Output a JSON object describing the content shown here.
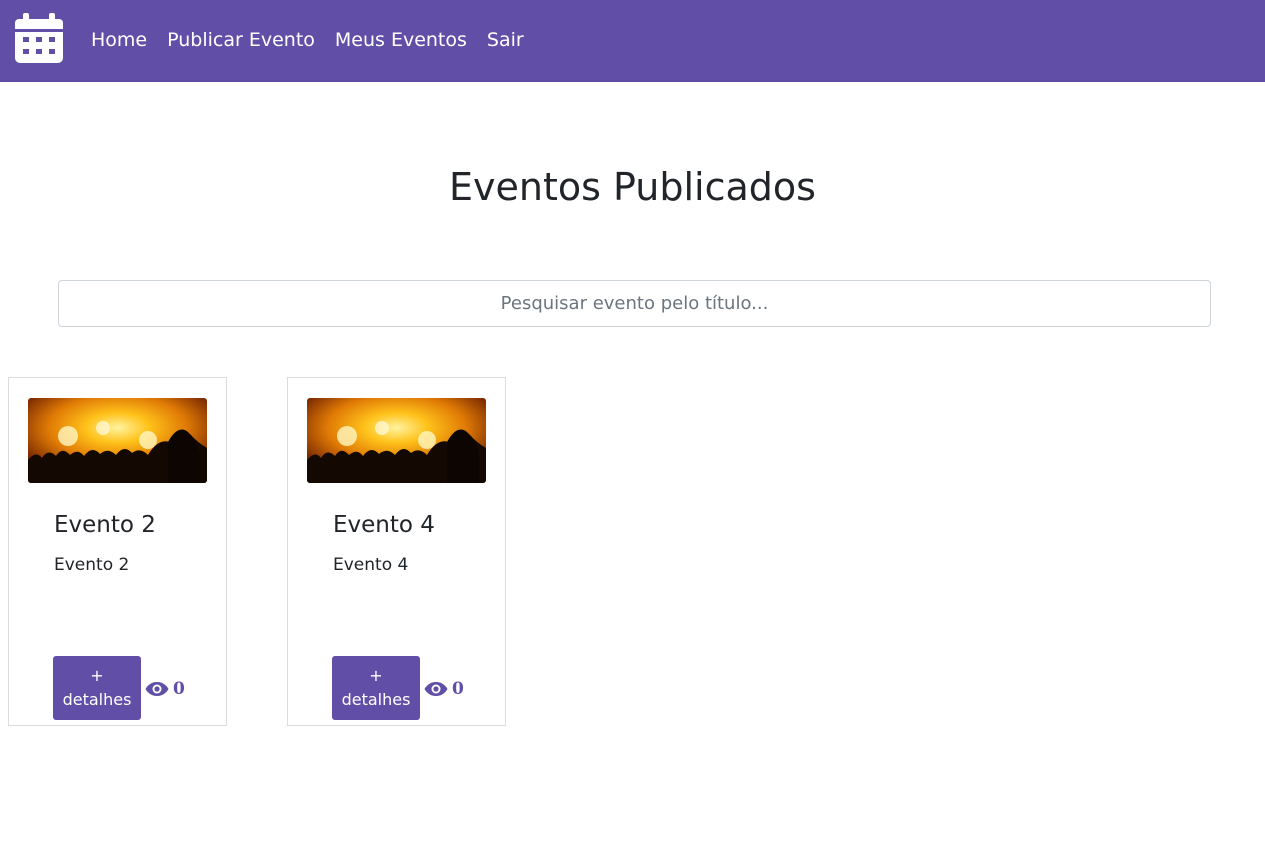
{
  "navbar": {
    "logo_icon": "calendar-icon",
    "background_color": "#614fa7",
    "links": [
      {
        "label": "Home"
      },
      {
        "label": "Publicar Evento"
      },
      {
        "label": "Meus Eventos"
      },
      {
        "label": "Sair"
      }
    ]
  },
  "main": {
    "title": "Eventos Publicados",
    "search": {
      "placeholder": "Pesquisar evento pelo título...",
      "value": ""
    },
    "events": [
      {
        "image": "concert-crowd-photo",
        "title": "Evento 2",
        "description": "Evento 2",
        "details_label": "+\ndetalhes",
        "view_icon": "eye-icon",
        "views": "0"
      },
      {
        "image": "concert-crowd-photo",
        "title": "Evento 4",
        "description": "Evento 4",
        "details_label": "+\ndetalhes",
        "view_icon": "eye-icon",
        "views": "0"
      }
    ]
  },
  "colors": {
    "accent": "#614fa7",
    "text": "#212529",
    "border": "#dcdcdc"
  }
}
